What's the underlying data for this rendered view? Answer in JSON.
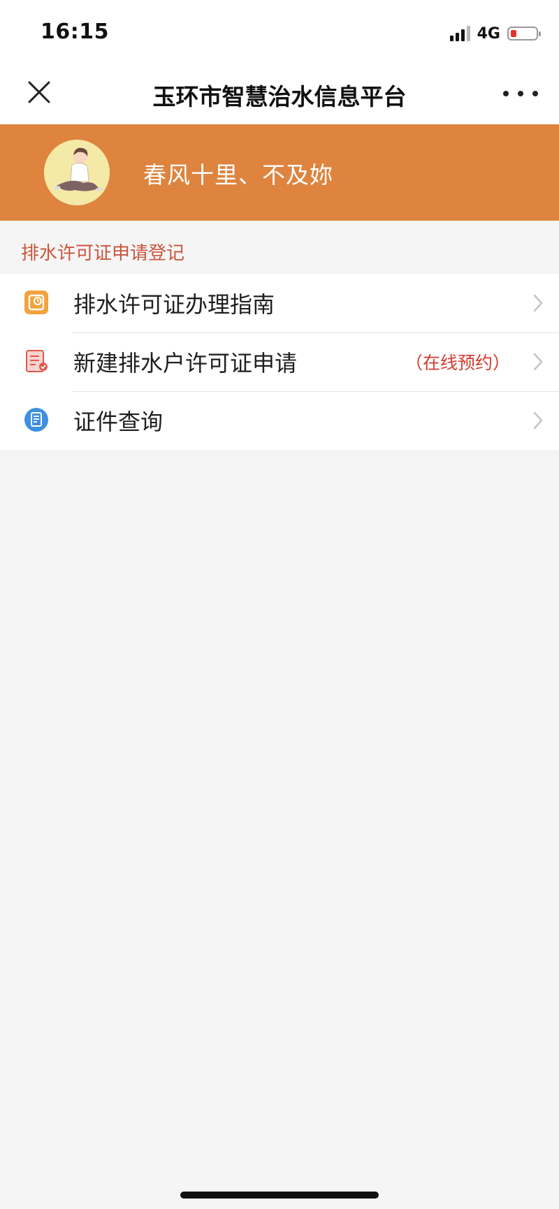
{
  "status_bar": {
    "time": "16:15",
    "network": "4G",
    "battery_color": "#e4352d"
  },
  "nav_bar": {
    "title": "玉环市智慧治水信息平台",
    "close_icon": "close-icon",
    "more_icon": "more-icon"
  },
  "profile": {
    "name": "春风十里、不及妳",
    "banner_color": "#de843e"
  },
  "section": {
    "title": "排水许可证申请登记",
    "items": [
      {
        "label": "排水许可证办理指南",
        "tag": "",
        "icon": "guide-icon"
      },
      {
        "label": "新建排水户许可证申请",
        "tag": "（在线预约）",
        "icon": "application-icon"
      },
      {
        "label": "证件查询",
        "tag": "",
        "icon": "document-search-icon"
      }
    ]
  }
}
